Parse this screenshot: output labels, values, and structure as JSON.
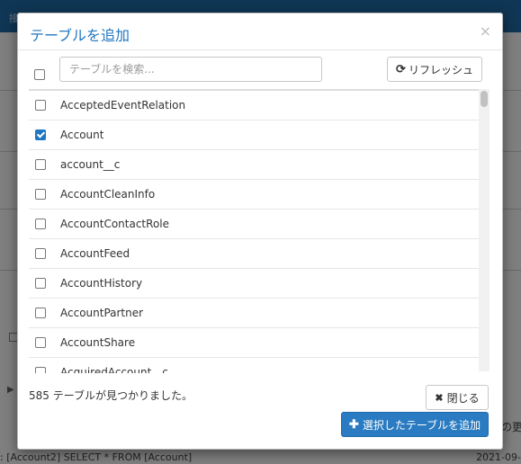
{
  "background": {
    "topbar_text": "接",
    "sql_text": "[Account2] SELECT * FROM [Account]",
    "date_text": "2021-09-",
    "right_text": "の更"
  },
  "modal": {
    "title": "テーブルを追加",
    "close_glyph": "×"
  },
  "search": {
    "placeholder": "テーブルを検索..."
  },
  "refresh": {
    "label": "リフレッシュ",
    "icon": "refresh-icon"
  },
  "tables": [
    {
      "name": "AcceptedEventRelation",
      "checked": false
    },
    {
      "name": "Account",
      "checked": true
    },
    {
      "name": "account__c",
      "checked": false
    },
    {
      "name": "AccountCleanInfo",
      "checked": false
    },
    {
      "name": "AccountContactRole",
      "checked": false
    },
    {
      "name": "AccountFeed",
      "checked": false
    },
    {
      "name": "AccountHistory",
      "checked": false
    },
    {
      "name": "AccountPartner",
      "checked": false
    },
    {
      "name": "AccountShare",
      "checked": false
    },
    {
      "name": "AcquiredAccount__c",
      "checked": false
    }
  ],
  "footer": {
    "count_text": "585 テーブルが見つかりました。",
    "close_label": "閉じる",
    "add_label": "選択したテーブルを追加"
  },
  "colors": {
    "accent": "#1f76c1",
    "primary_button": "#2a7bc1",
    "topbar": "#1f6da8"
  }
}
